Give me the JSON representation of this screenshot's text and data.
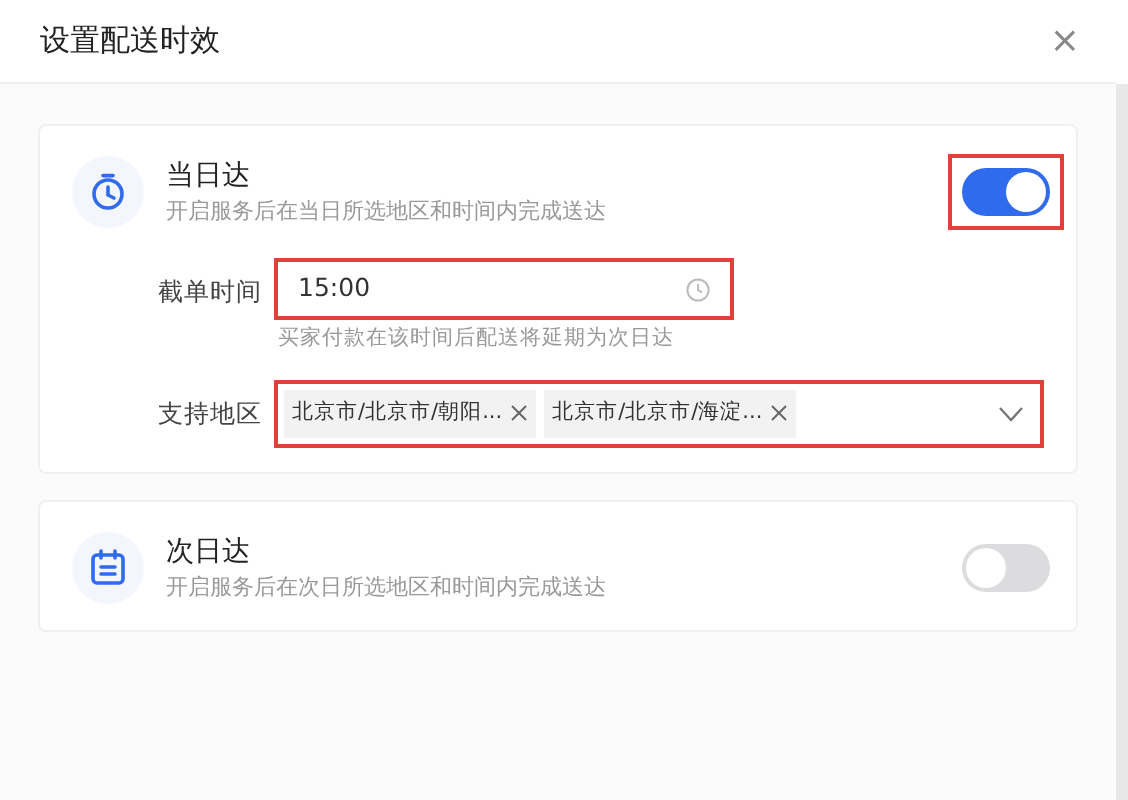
{
  "dialog": {
    "title": "设置配送时效",
    "close": "×"
  },
  "options": [
    {
      "kind": "same_day",
      "title": "当日达",
      "description": "开启服务后在当日所选地区和时间内完成送达",
      "on": true,
      "highlighted": true,
      "fields": [
        {
          "kind": "time",
          "label": "截单时间",
          "value": "15:00",
          "hint": "买家付款在该时间后配送将延期为次日达",
          "highlighted": true
        },
        {
          "kind": "regions",
          "label": "支持地区",
          "highlighted": true,
          "tags": [
            {
              "label": "北京市/北京市/朝阳..."
            },
            {
              "label": "北京市/北京市/海淀..."
            }
          ]
        }
      ]
    },
    {
      "kind": "next_day",
      "title": "次日达",
      "description": "开启服务后在次日所选地区和时间内完成送达",
      "on": false,
      "highlighted": false
    }
  ]
}
